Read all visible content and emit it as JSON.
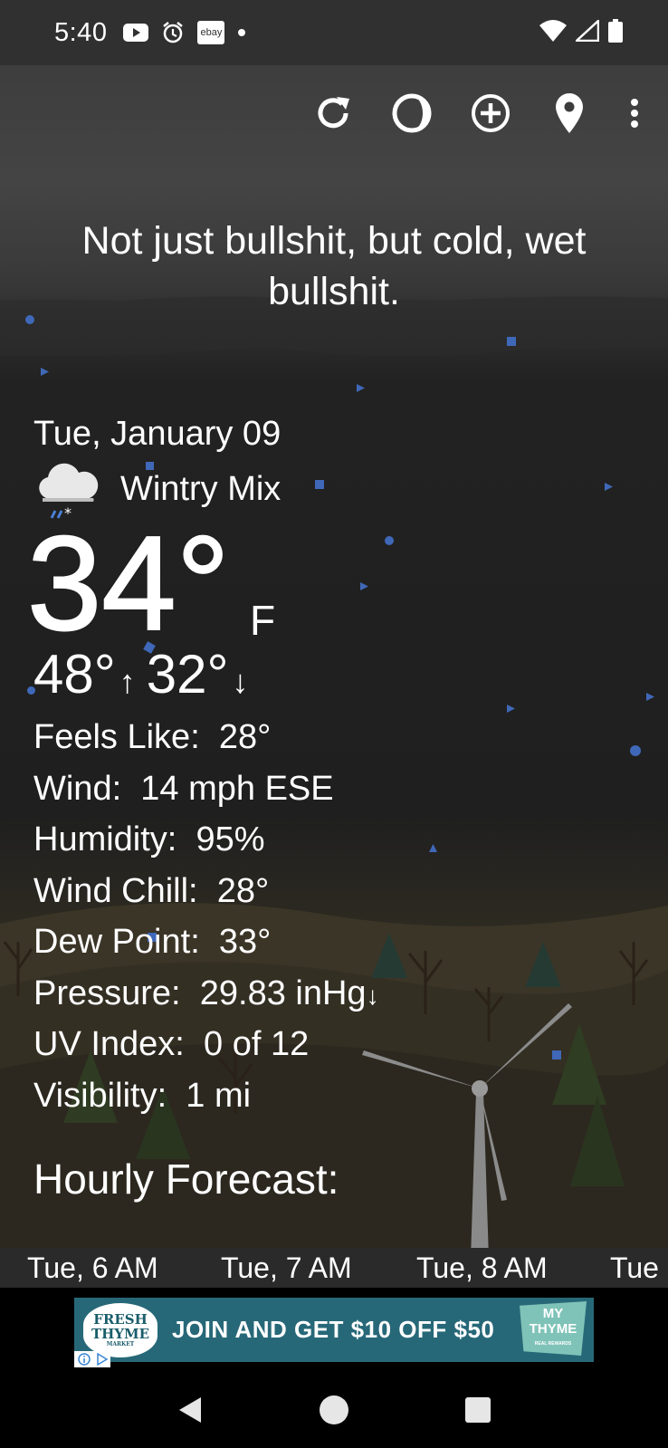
{
  "status_bar": {
    "time": "5:40",
    "left_icons": [
      "youtube-icon",
      "alarm-icon",
      "ebay-icon",
      "dot-icon"
    ],
    "ebay_label": "ebay",
    "right_icons": [
      "wifi-icon",
      "signal-icon",
      "battery-icon"
    ]
  },
  "toolbar": {
    "actions": [
      "refresh-icon",
      "theme-icon",
      "add-location-icon",
      "location-pin-icon",
      "more-vert-icon"
    ]
  },
  "quote": "Not just bullshit, but cold, wet bullshit.",
  "current": {
    "date": "Tue, January 09",
    "condition": "Wintry Mix",
    "condition_icon": "wintry-mix-icon",
    "temperature": "34°",
    "unit": "F",
    "high": "48°",
    "high_arrow": "↑",
    "low": "32°",
    "low_arrow": "↓"
  },
  "details": [
    {
      "label": "Feels Like:",
      "value": "28°"
    },
    {
      "label": "Wind:",
      "value": "14 mph ESE"
    },
    {
      "label": "Humidity:",
      "value": "95%"
    },
    {
      "label": "Wind Chill:",
      "value": "28°"
    },
    {
      "label": "Dew Point:",
      "value": "33°"
    },
    {
      "label": "Pressure:",
      "value": "29.83 inHg",
      "trend": "↓"
    },
    {
      "label": "UV Index:",
      "value": "0 of 12"
    },
    {
      "label": "Visibility:",
      "value": "1 mi"
    }
  ],
  "hourly": {
    "title": "Hourly Forecast:",
    "hours": [
      "Tue, 6 AM",
      "Tue, 7 AM",
      "Tue, 8 AM",
      "Tue"
    ]
  },
  "ad": {
    "brand_line1": "FRESH",
    "brand_line2": "THYME",
    "brand_line3": "MARKET",
    "text": "JOIN AND GET $10 OFF $50",
    "badge_line1": "MY",
    "badge_line2": "THYME",
    "badge_line3": "REAL REWARDS",
    "colors": {
      "banner": "#276878",
      "badge": "#7fc3b8"
    }
  },
  "nav": [
    "back-icon",
    "home-icon",
    "recents-icon"
  ],
  "colors": {
    "snowflake": "#3f68b8",
    "status_bar": "#303030"
  }
}
